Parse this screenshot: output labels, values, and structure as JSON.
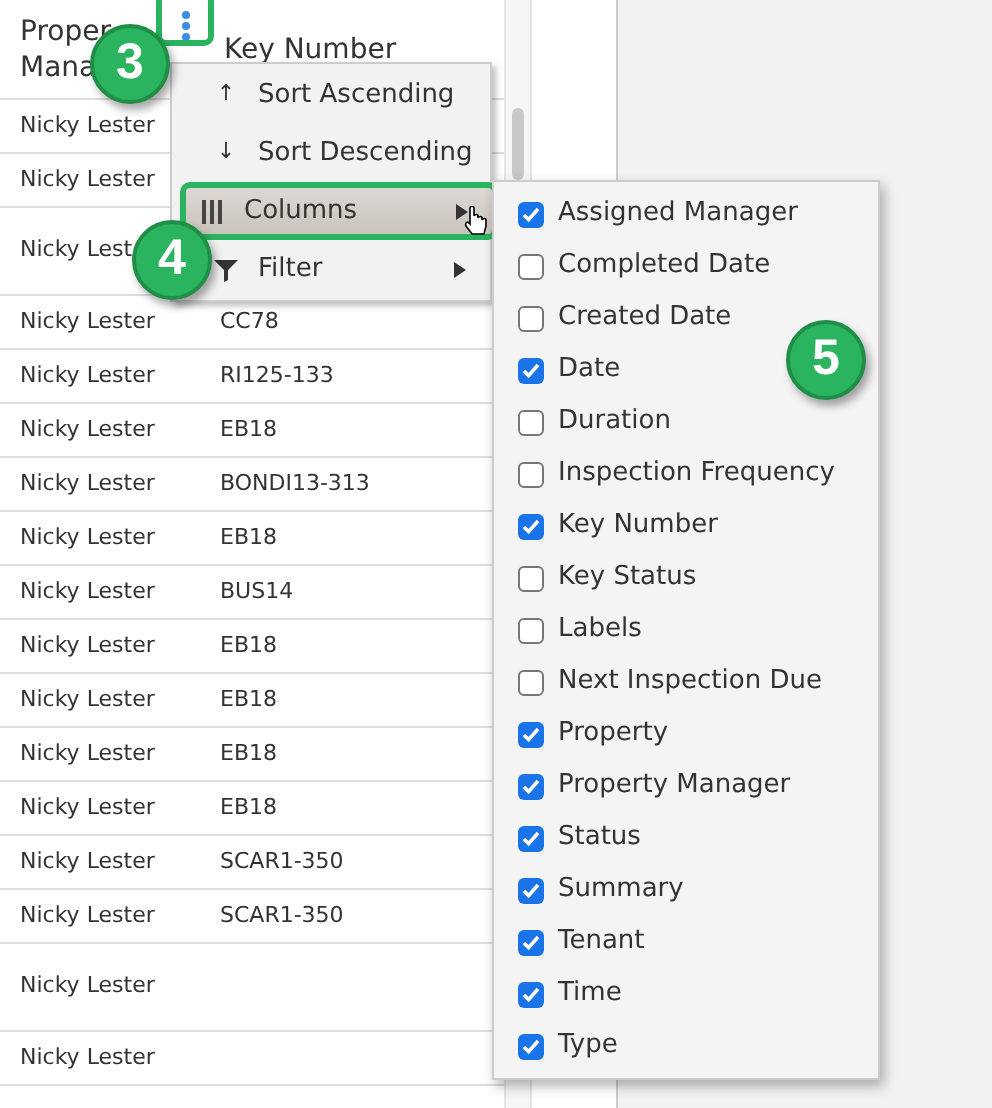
{
  "table": {
    "columns": [
      {
        "lines": [
          "Proper",
          "Mana"
        ]
      },
      {
        "lines": [
          "Key Number"
        ]
      }
    ],
    "rows": [
      {
        "kind": "normal",
        "manager": "Nicky Lester",
        "key": ""
      },
      {
        "kind": "normal",
        "manager": "Nicky Lester",
        "key": ""
      },
      {
        "kind": "tall",
        "manager": "Nicky Lest",
        "key": ""
      },
      {
        "kind": "normal",
        "manager": "Nicky Lester",
        "key": "CC78"
      },
      {
        "kind": "normal",
        "manager": "Nicky Lester",
        "key": "RI125-133"
      },
      {
        "kind": "normal",
        "manager": "Nicky Lester",
        "key": "EB18"
      },
      {
        "kind": "normal",
        "manager": "Nicky Lester",
        "key": "BONDI13-313"
      },
      {
        "kind": "normal",
        "manager": "Nicky Lester",
        "key": "EB18"
      },
      {
        "kind": "normal",
        "manager": "Nicky Lester",
        "key": "BUS14"
      },
      {
        "kind": "normal",
        "manager": "Nicky Lester",
        "key": "EB18"
      },
      {
        "kind": "normal",
        "manager": "Nicky Lester",
        "key": "EB18"
      },
      {
        "kind": "normal",
        "manager": "Nicky Lester",
        "key": "EB18"
      },
      {
        "kind": "normal",
        "manager": "Nicky Lester",
        "key": "EB18"
      },
      {
        "kind": "normal",
        "manager": "Nicky Lester",
        "key": "SCAR1-350"
      },
      {
        "kind": "normal",
        "manager": "Nicky Lester",
        "key": "SCAR1-350"
      },
      {
        "kind": "tall",
        "manager": "Nicky Lester",
        "key": ""
      },
      {
        "kind": "normal",
        "manager": "Nicky Lester",
        "key": ""
      }
    ]
  },
  "column_menu": {
    "items": [
      {
        "kind": "sort",
        "icon": "↑",
        "label": "Sort Ascending",
        "selected": false
      },
      {
        "kind": "sort",
        "icon": "↓",
        "label": "Sort Descending",
        "selected": false
      },
      {
        "kind": "columns",
        "label": "Columns",
        "selected": true
      },
      {
        "kind": "filter",
        "label": "Filter",
        "selected": false
      }
    ]
  },
  "columns_submenu": {
    "items": [
      {
        "label": "Assigned Manager",
        "checked": true
      },
      {
        "label": "Completed Date",
        "checked": false
      },
      {
        "label": "Created Date",
        "checked": false
      },
      {
        "label": "Date",
        "checked": true
      },
      {
        "label": "Duration",
        "checked": false
      },
      {
        "label": "Inspection Frequency",
        "checked": false
      },
      {
        "label": "Key Number",
        "checked": true
      },
      {
        "label": "Key Status",
        "checked": false
      },
      {
        "label": "Labels",
        "checked": false
      },
      {
        "label": "Next Inspection Due",
        "checked": false
      },
      {
        "label": "Property",
        "checked": true
      },
      {
        "label": "Property Manager",
        "checked": true
      },
      {
        "label": "Status",
        "checked": true
      },
      {
        "label": "Summary",
        "checked": true
      },
      {
        "label": "Tenant",
        "checked": true
      },
      {
        "label": "Time",
        "checked": true
      },
      {
        "label": "Type",
        "checked": true
      }
    ]
  },
  "callouts": [
    {
      "label": "3"
    },
    {
      "label": "4"
    },
    {
      "label": "5"
    }
  ]
}
